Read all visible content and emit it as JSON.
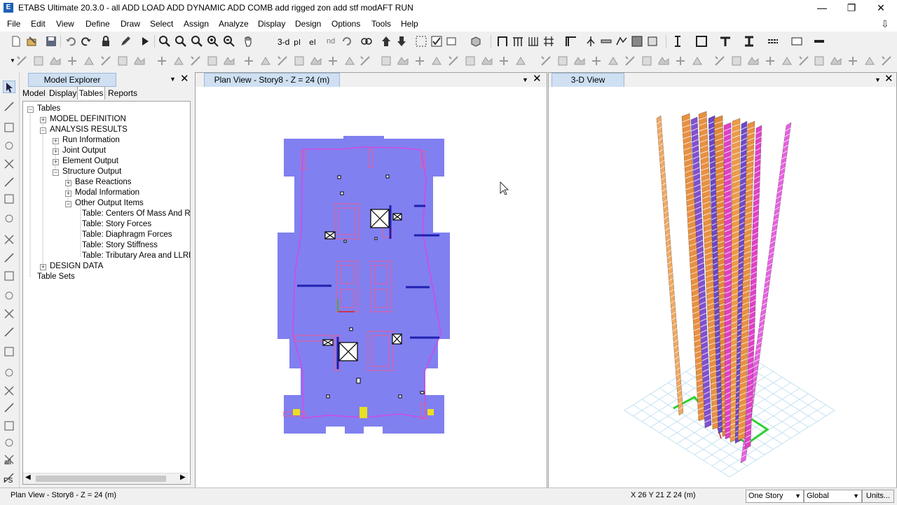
{
  "window": {
    "title": "ETABS Ultimate 20.3.0 -  all ADD LOAD ADD DYNAMIC ADD COMB add rigged zon add stf modAFT RUN",
    "app_icon": "E",
    "controls": {
      "minimize": "—",
      "restore": "❐",
      "close": "✕"
    }
  },
  "menu": [
    "File",
    "Edit",
    "View",
    "Define",
    "Draw",
    "Select",
    "Assign",
    "Analyze",
    "Display",
    "Design",
    "Options",
    "Tools",
    "Help"
  ],
  "toolbar1_text": {
    "three_d": "3-d",
    "nd": "nd"
  },
  "left_toolbar_text": {
    "all": "all",
    "ps": "PS"
  },
  "explorer": {
    "title": "Model Explorer",
    "tabs": [
      "Model",
      "Display",
      "Tables",
      "Reports"
    ],
    "active_tab": "Tables",
    "tree": [
      {
        "label": "Tables",
        "expander": "−"
      },
      {
        "label": "MODEL DEFINITION",
        "expander": "+"
      },
      {
        "label": "ANALYSIS RESULTS",
        "expander": "−"
      },
      {
        "label": "Run Information",
        "expander": "+"
      },
      {
        "label": "Joint Output",
        "expander": "+"
      },
      {
        "label": "Element Output",
        "expander": "+"
      },
      {
        "label": "Structure Output",
        "expander": "−"
      },
      {
        "label": "Base Reactions",
        "expander": "+"
      },
      {
        "label": "Modal Information",
        "expander": "+"
      },
      {
        "label": "Other Output Items",
        "expander": "−"
      },
      {
        "label": "Table:  Centers Of Mass And Rig",
        "expander": ""
      },
      {
        "label": "Table:  Story Forces",
        "expander": ""
      },
      {
        "label": "Table:  Diaphragm Forces",
        "expander": ""
      },
      {
        "label": "Table:  Story Stiffness",
        "expander": ""
      },
      {
        "label": "Table:  Tributary Area and LLRF",
        "expander": ""
      },
      {
        "label": "DESIGN DATA",
        "expander": "+"
      },
      {
        "label": "Table Sets",
        "expander": ""
      }
    ]
  },
  "plan_view": {
    "title": "Plan View - Story8 - Z = 24 (m)",
    "slab_color": "#8080f0",
    "wall_color": "#e040e0"
  },
  "three_d_view": {
    "title": "3-D View"
  },
  "status": {
    "left": "Plan View - Story8 - Z = 24 (m)",
    "coords": "X 26  Y 21  Z 24 (m)",
    "story_select": "One Story",
    "coord_system": "Global",
    "units_button": "Units..."
  }
}
